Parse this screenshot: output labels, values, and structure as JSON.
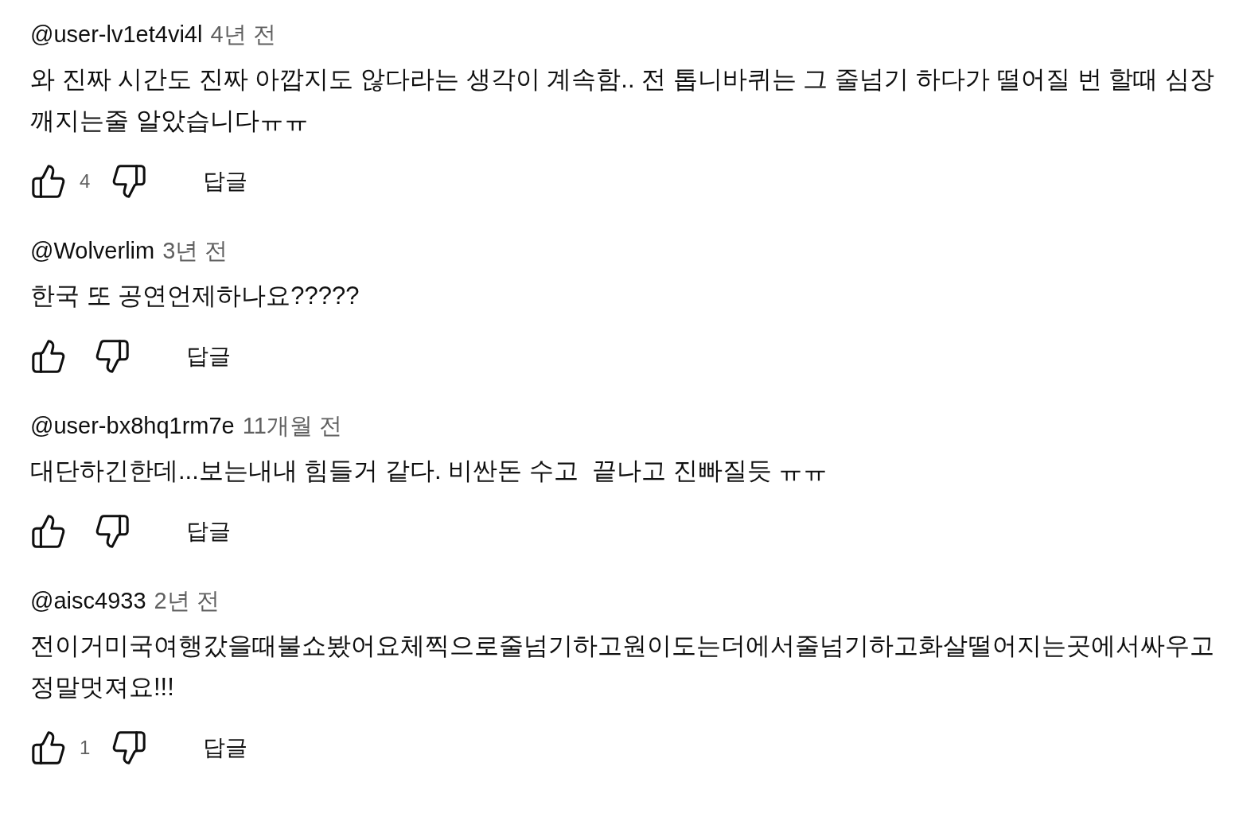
{
  "comments": [
    {
      "author": "@user-lv1et4vi4l",
      "time": "4년 전",
      "text": "와 진짜 시간도 진짜 아깝지도 않다라는 생각이 계속함.. 전 톱니바퀴는 그 줄넘기 하다가 떨어질 번 할때 심장 깨지는줄 알았습니다ㅠㅠ",
      "likes": "4",
      "reply": "답글"
    },
    {
      "author": "@Wolverlim",
      "time": "3년 전",
      "text": "한국 또 공연언제하나요?????",
      "reply": "답글"
    },
    {
      "author": "@user-bx8hq1rm7e",
      "time": "11개월 전",
      "text": "대단하긴한데...보는내내 힘들거 같다. 비싼돈 수고  끝나고 진빠질듯 ㅠㅠ",
      "reply": "답글"
    },
    {
      "author": "@aisc4933",
      "time": "2년 전",
      "text": "전이거미국여행갔을때불쇼봤어요체찍으로줄넘기하고원이도는더에서줄넘기하고화살떨어지는곳에서싸우고정말멋져요!!!",
      "likes": "1",
      "reply": "답글"
    }
  ]
}
